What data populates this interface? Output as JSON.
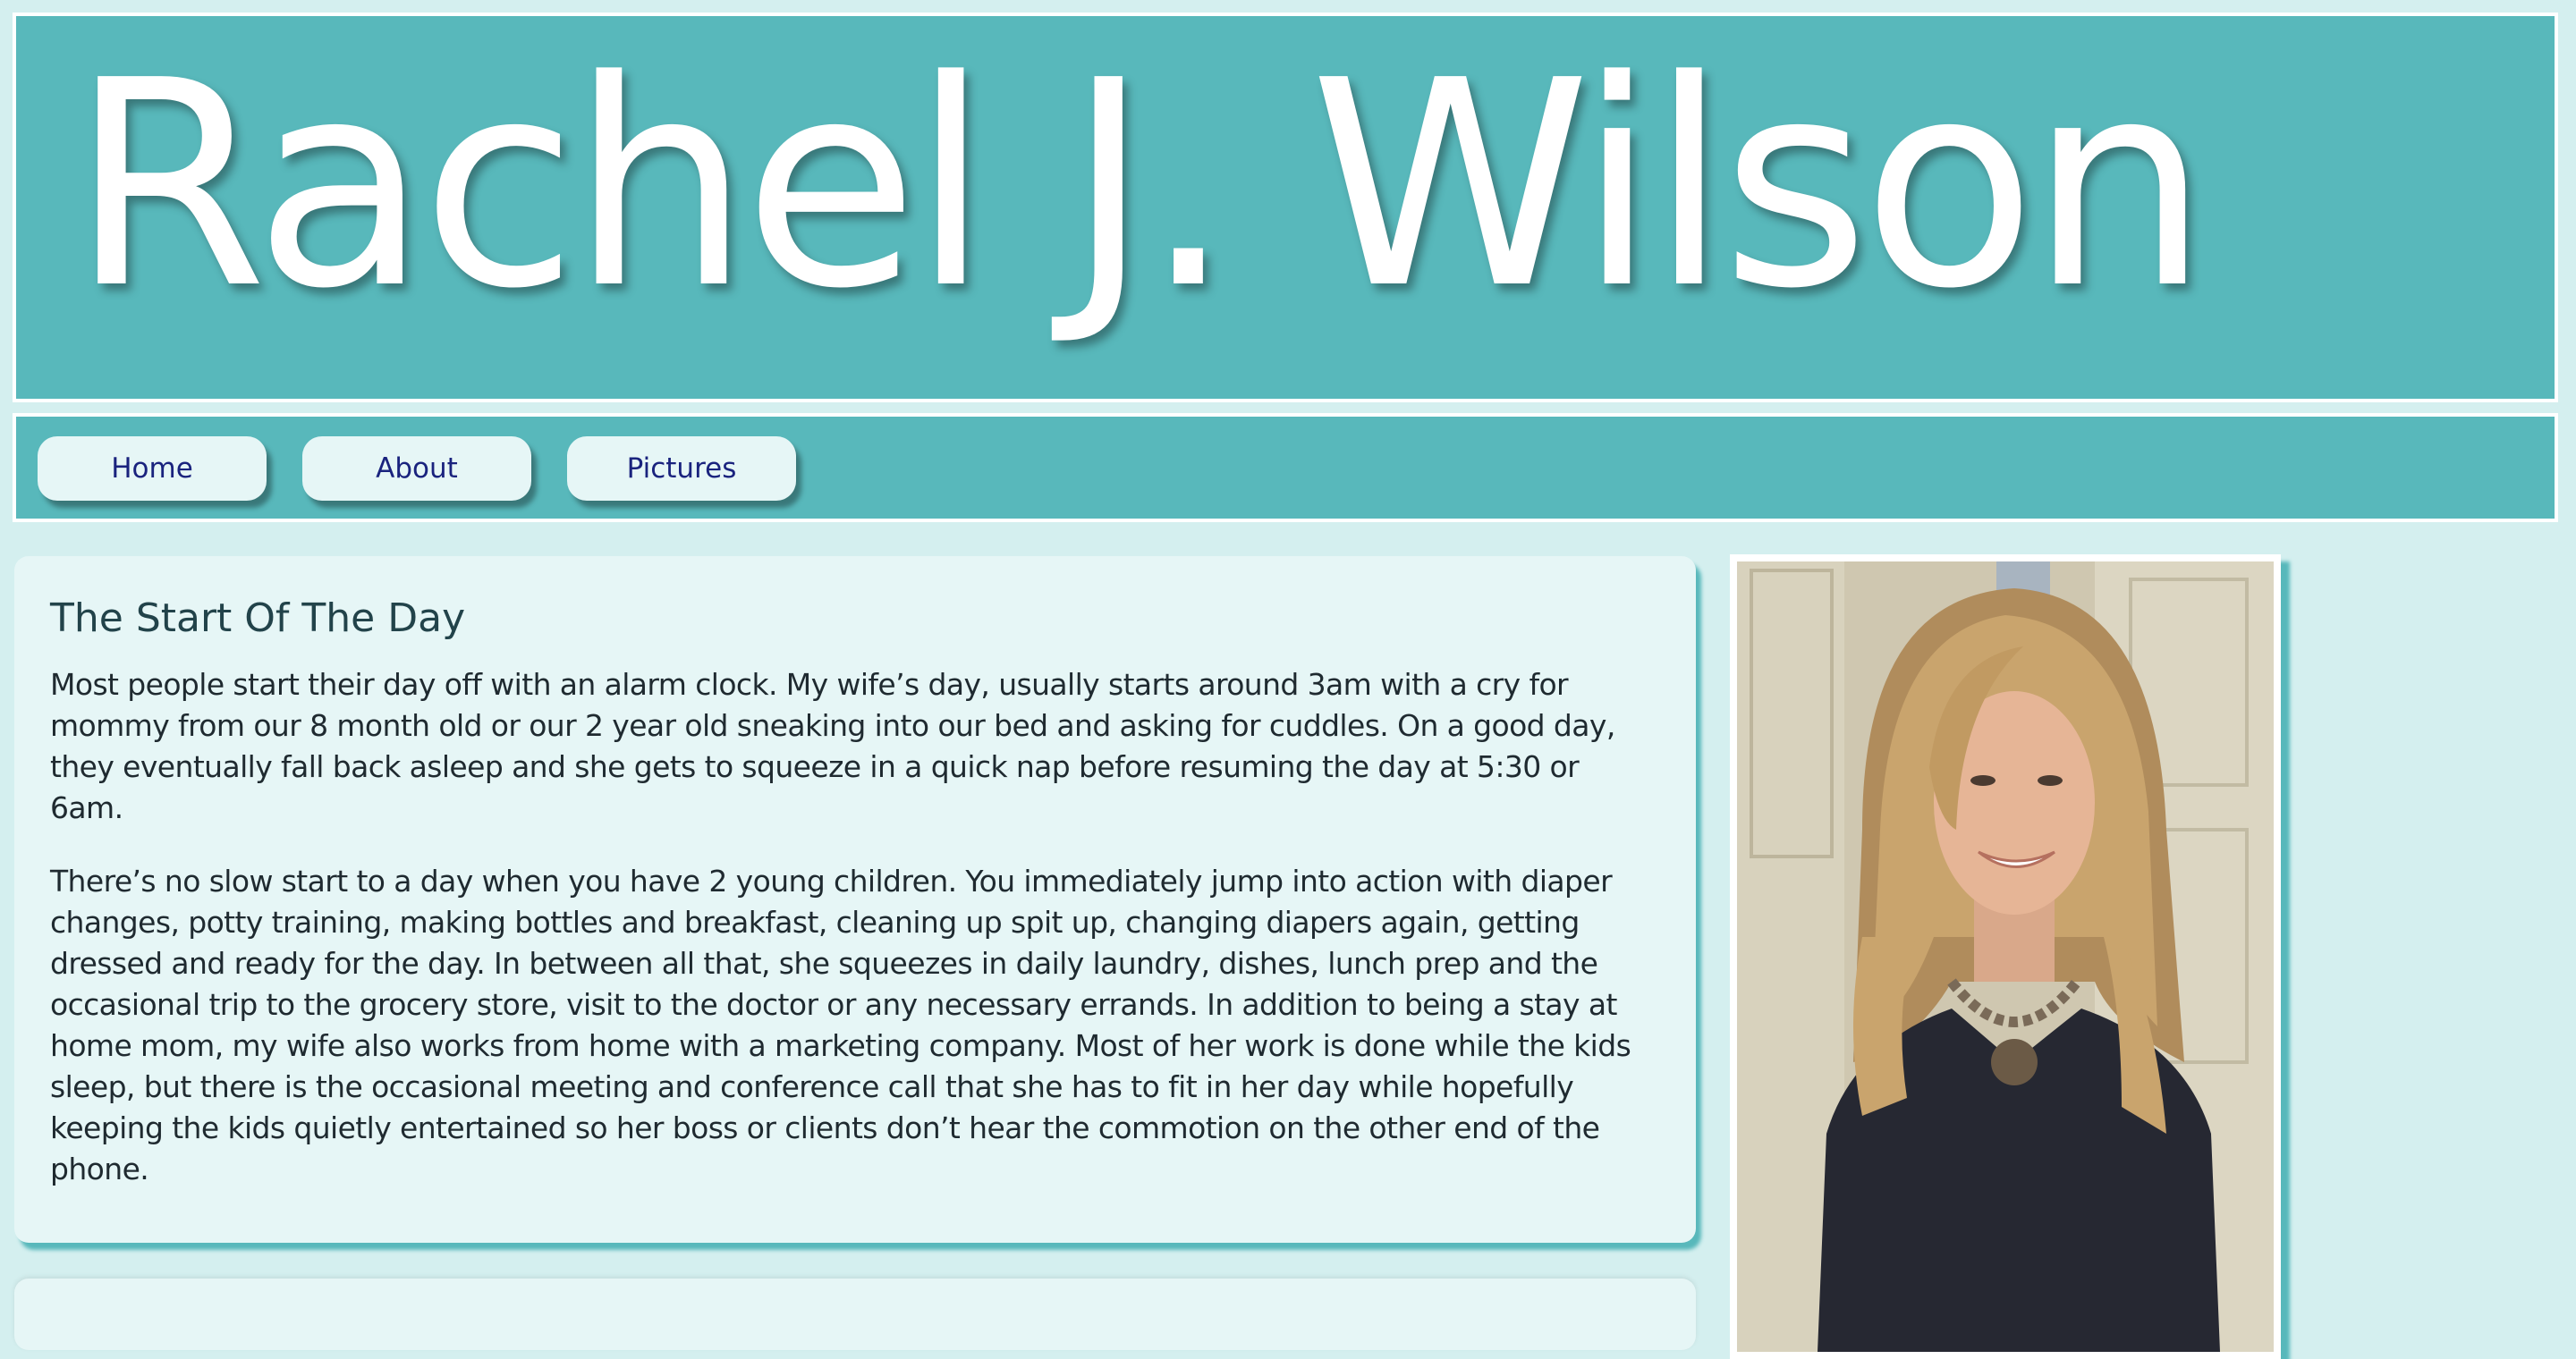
{
  "header": {
    "title": "Rachel J. Wilson"
  },
  "nav": {
    "items": [
      {
        "label": "Home"
      },
      {
        "label": "About"
      },
      {
        "label": "Pictures"
      }
    ]
  },
  "post": {
    "title": "The Start Of The Day",
    "paragraphs": [
      "Most people start their day off with an alarm clock. My wife’s day, usually starts around 3am with a cry for mommy from our 8 month old or our 2 year old sneaking into our bed and asking for cuddles. On a good day, they eventually fall back asleep and she gets to squeeze in a quick nap before resuming the day at 5:30 or 6am.",
      "There’s no slow start to a day when you have 2 young children. You immediately jump into action with diaper changes, potty training, making bottles and breakfast, cleaning up spit up, changing diapers again, getting dressed and ready for the day. In between all that, she squeezes in daily laundry, dishes, lunch prep and the occasional trip to the grocery store, visit to the doctor or any necessary errands. In addition to being a stay at home mom, my wife also works from home with a marketing company. Most of her work is done while the kids sleep, but there is the occasional meeting and conference call that she has to fit in her day while hopefully keeping the kids quietly entertained so her boss or clients don’t hear the commotion on the other end of the phone."
    ]
  },
  "colors": {
    "page_background": "#d4efef",
    "banner": "#58b8bb",
    "card": "#e6f6f6",
    "nav_text": "#1a237e"
  }
}
